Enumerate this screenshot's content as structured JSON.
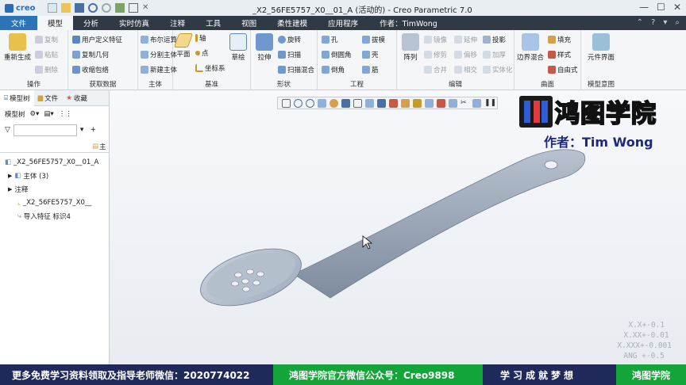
{
  "app": {
    "logo": "creo",
    "window_title": "_X2_56FE5757_X0__01_A (活动的) - Creo Parametric 7.0"
  },
  "tabs": [
    "文件",
    "模型",
    "分析",
    "实时仿真",
    "注释",
    "工具",
    "视图",
    "柔性建模",
    "应用程序"
  ],
  "author_tab": "作者：TimWong",
  "ribbon": {
    "operations": {
      "regen": "重新生成",
      "copy": "复制",
      "paste": "粘贴",
      "delete": "删除",
      "label": "操作"
    },
    "get_data": {
      "udf": "用户定义特征",
      "copy_geom": "复制几何",
      "shrinkwrap": "收缩包络",
      "label": "获取数据"
    },
    "body": {
      "boolean": "布尔运算",
      "split": "分割主体",
      "new_body": "新建主体",
      "label": "主体"
    },
    "datum": {
      "plane": "平面",
      "axis": "轴",
      "point": "点",
      "csys": "坐标系",
      "sketch": "草绘",
      "label": "基准"
    },
    "shapes": {
      "extrude": "拉伸",
      "revolve": "旋转",
      "sweep": "扫描",
      "swept_blend": "扫描混合",
      "label": "形状"
    },
    "engineering": {
      "hole": "孔",
      "draft": "拔模",
      "round": "倒圆角",
      "shell": "壳",
      "chamfer": "倒角",
      "rib": "筋",
      "label": "工程"
    },
    "editing": {
      "pattern": "阵列",
      "mirror": "镜像",
      "extend": "延伸",
      "project": "投影",
      "trim": "修剪",
      "offset": "偏移",
      "thicken": "加厚",
      "merge": "合并",
      "intersect": "相交",
      "solidify": "实体化",
      "label": "编辑"
    },
    "surfaces": {
      "boundary_blend": "边界混合",
      "fill": "填充",
      "style": "样式",
      "freestyle": "自由式",
      "label": "曲面"
    },
    "model_intent": {
      "component_interface": "元件界面",
      "label": "模型意图"
    }
  },
  "left_panel": {
    "tabs": [
      "模型树",
      "文件",
      "收藏"
    ],
    "tree_menu": "模型树",
    "column_label": "主",
    "tree": [
      "_X2_56FE5757_X0__01_A",
      "主体 (3)",
      "注释",
      "_X2_56FE5757_X0__",
      "导入特征 标识4"
    ]
  },
  "watermark": {
    "brand": "鸿图学院",
    "author": "作者：Tim Wong"
  },
  "tolerance": [
    "X.X+-0.1",
    "X.XX+-0.01",
    "X.XXX+-0.001",
    "ANG +-0.5"
  ],
  "banner": {
    "wechat": "更多免费学习资料领取及指导老师微信：2020774022",
    "official": "鸿图学院官方微信公众号：Creo9898",
    "slogan": "学习成就梦想",
    "brand": "鸿图学院"
  },
  "colors": {
    "tab_bar": "#2f3a45",
    "file_tab": "#2d73b8",
    "banner_navy": "#1f2a5a",
    "banner_green": "#13a43a",
    "part_blue": "#9aa6b6"
  }
}
